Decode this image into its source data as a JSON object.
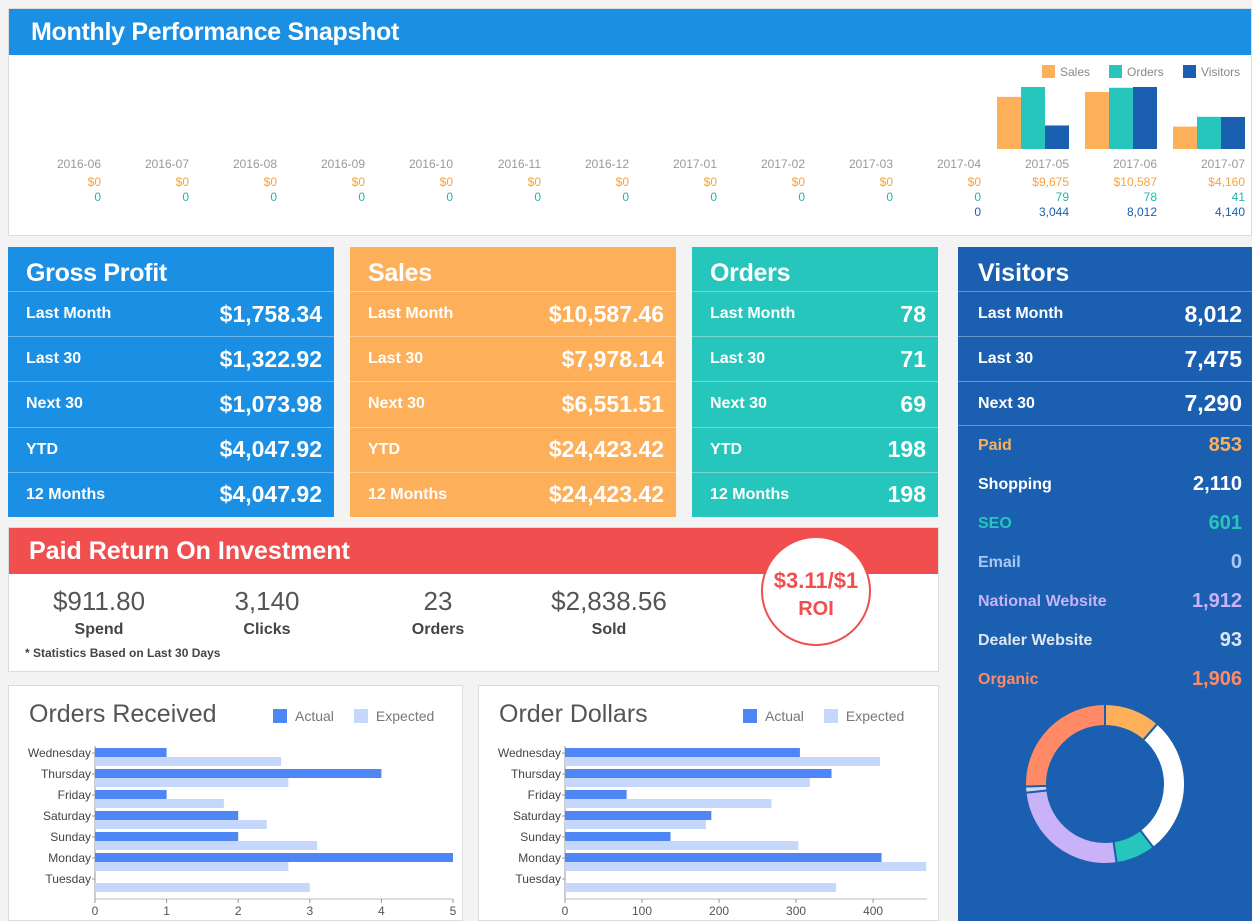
{
  "header": {
    "title": "Monthly Performance Snapshot"
  },
  "snapshot": {
    "legend": [
      {
        "label": "Sales",
        "color": "#fdaf5a"
      },
      {
        "label": "Orders",
        "color": "#27c6bc"
      },
      {
        "label": "Visitors",
        "color": "#1b5fb0"
      }
    ],
    "months": [
      "2016-06",
      "2016-07",
      "2016-08",
      "2016-09",
      "2016-10",
      "2016-11",
      "2016-12",
      "2017-01",
      "2017-02",
      "2017-03",
      "2017-04",
      "2017-05",
      "2017-06",
      "2017-07"
    ],
    "sales_labels": [
      "$0",
      "$0",
      "$0",
      "$0",
      "$0",
      "$0",
      "$0",
      "$0",
      "$0",
      "$0",
      "$0",
      "$9,675",
      "$10,587",
      "$4,160"
    ],
    "orders_labels": [
      "0",
      "0",
      "0",
      "0",
      "0",
      "0",
      "0",
      "0",
      "0",
      "0",
      "0",
      "79",
      "78",
      "41"
    ],
    "visitors_labels": [
      "",
      "",
      "",
      "",
      "",
      "",
      "",
      "",
      "",
      "",
      "0",
      "3,044",
      "8,012",
      "4,140"
    ]
  },
  "chart_data": [
    {
      "type": "bar",
      "title": "Monthly Performance Snapshot",
      "categories": [
        "2016-06",
        "2016-07",
        "2016-08",
        "2016-09",
        "2016-10",
        "2016-11",
        "2016-12",
        "2017-01",
        "2017-02",
        "2017-03",
        "2017-04",
        "2017-05",
        "2017-06",
        "2017-07"
      ],
      "series": [
        {
          "name": "Sales",
          "values": [
            0,
            0,
            0,
            0,
            0,
            0,
            0,
            0,
            0,
            0,
            0,
            9675,
            10587,
            4160
          ]
        },
        {
          "name": "Orders",
          "values": [
            0,
            0,
            0,
            0,
            0,
            0,
            0,
            0,
            0,
            0,
            0,
            79,
            78,
            41
          ]
        },
        {
          "name": "Visitors",
          "values": [
            null,
            null,
            null,
            null,
            null,
            null,
            null,
            null,
            null,
            null,
            0,
            3044,
            8012,
            4140
          ]
        }
      ],
      "legend": "top-right"
    },
    {
      "type": "bar",
      "title": "Orders Received",
      "orientation": "horizontal",
      "categories": [
        "Wednesday",
        "Thursday",
        "Friday",
        "Saturday",
        "Sunday",
        "Monday",
        "Tuesday"
      ],
      "series": [
        {
          "name": "Actual",
          "values": [
            1,
            4,
            1,
            2,
            2,
            5,
            0
          ]
        },
        {
          "name": "Expected",
          "values": [
            2.6,
            2.7,
            1.8,
            2.4,
            3.1,
            2.7,
            3.0
          ]
        }
      ],
      "xticks": [
        "0",
        "1",
        "2",
        "3",
        "4",
        "5"
      ],
      "xlim": [
        0,
        5
      ],
      "legend": "top-right"
    },
    {
      "type": "bar",
      "title": "Order Dollars",
      "orientation": "horizontal",
      "categories": [
        "Wednesday",
        "Thursday",
        "Friday",
        "Saturday",
        "Sunday",
        "Monday",
        "Tuesday"
      ],
      "series": [
        {
          "name": "Actual",
          "values": [
            305,
            346,
            80,
            190,
            137,
            411,
            0
          ]
        },
        {
          "name": "Expected",
          "values": [
            409,
            318,
            268,
            183,
            303,
            469,
            352
          ]
        }
      ],
      "xticks": [
        "0",
        "100",
        "200",
        "300",
        "400"
      ],
      "xlim": [
        0,
        470
      ],
      "legend": "top-right"
    },
    {
      "type": "pie",
      "title": "",
      "categories": [
        "Paid",
        "Shopping",
        "SEO",
        "Email",
        "National Website",
        "Dealer Website",
        "Organic"
      ],
      "values": [
        853,
        2110,
        601,
        0,
        1912,
        93,
        1906
      ],
      "colors": [
        "#fdaf5a",
        "#ffffff",
        "#27c6bc",
        "#8fb3e8",
        "#c9b2f7",
        "#cfd8e8",
        "#ff8a65"
      ]
    }
  ],
  "gross_profit": {
    "title": "Gross Profit",
    "rows": [
      {
        "label": "Last Month",
        "value": "$1,758.34"
      },
      {
        "label": "Last 30",
        "value": "$1,322.92"
      },
      {
        "label": "Next 30",
        "value": "$1,073.98"
      },
      {
        "label": "YTD",
        "value": "$4,047.92"
      },
      {
        "label": "12 Months",
        "value": "$4,047.92"
      }
    ]
  },
  "sales": {
    "title": "Sales",
    "rows": [
      {
        "label": "Last Month",
        "value": "$10,587.46"
      },
      {
        "label": "Last 30",
        "value": "$7,978.14"
      },
      {
        "label": "Next 30",
        "value": "$6,551.51"
      },
      {
        "label": "YTD",
        "value": "$24,423.42"
      },
      {
        "label": "12 Months",
        "value": "$24,423.42"
      }
    ]
  },
  "orders": {
    "title": "Orders",
    "rows": [
      {
        "label": "Last Month",
        "value": "78"
      },
      {
        "label": "Last 30",
        "value": "71"
      },
      {
        "label": "Next 30",
        "value": "69"
      },
      {
        "label": "YTD",
        "value": "198"
      },
      {
        "label": "12 Months",
        "value": "198"
      }
    ]
  },
  "visitors": {
    "title": "Visitors",
    "rows": [
      {
        "label": "Last Month",
        "value": "8,012"
      },
      {
        "label": "Last 30",
        "value": "7,475"
      },
      {
        "label": "Next 30",
        "value": "7,290"
      }
    ],
    "sources": [
      {
        "label": "Paid",
        "value": "853",
        "color": "#fdaf5a"
      },
      {
        "label": "Shopping",
        "value": "2,110",
        "color": "#ffffff"
      },
      {
        "label": "SEO",
        "value": "601",
        "color": "#27c6bc"
      },
      {
        "label": "Email",
        "value": "0",
        "color": "#a9c8f5"
      },
      {
        "label": "National Website",
        "value": "1,912",
        "color": "#c9b2f7"
      },
      {
        "label": "Dealer Website",
        "value": "93",
        "color": "#dfe6f2"
      },
      {
        "label": "Organic",
        "value": "1,906",
        "color": "#ff8a65"
      }
    ]
  },
  "roi": {
    "title": "Paid Return On Investment",
    "stats": [
      {
        "value": "$911.80",
        "caption": "Spend"
      },
      {
        "value": "3,140",
        "caption": "Clicks"
      },
      {
        "value": "23",
        "caption": "Orders"
      },
      {
        "value": "$2,838.56",
        "caption": "Sold"
      }
    ],
    "note": "* Statistics Based on Last 30 Days",
    "ratio": "$3.11/$1",
    "ratio_label": "ROI"
  },
  "orders_received": {
    "title": "Orders Received",
    "legend_actual": "Actual",
    "legend_expected": "Expected"
  },
  "order_dollars": {
    "title": "Order Dollars",
    "legend_actual": "Actual",
    "legend_expected": "Expected"
  },
  "colors": {
    "actual": "#4e86f5",
    "expected": "#c5d8fb",
    "blue_header": "#1a8fe3",
    "sales": "#fdaf5a",
    "orders": "#27c6bc",
    "visitors": "#1b5fb0",
    "roi": "#f04e4f"
  }
}
